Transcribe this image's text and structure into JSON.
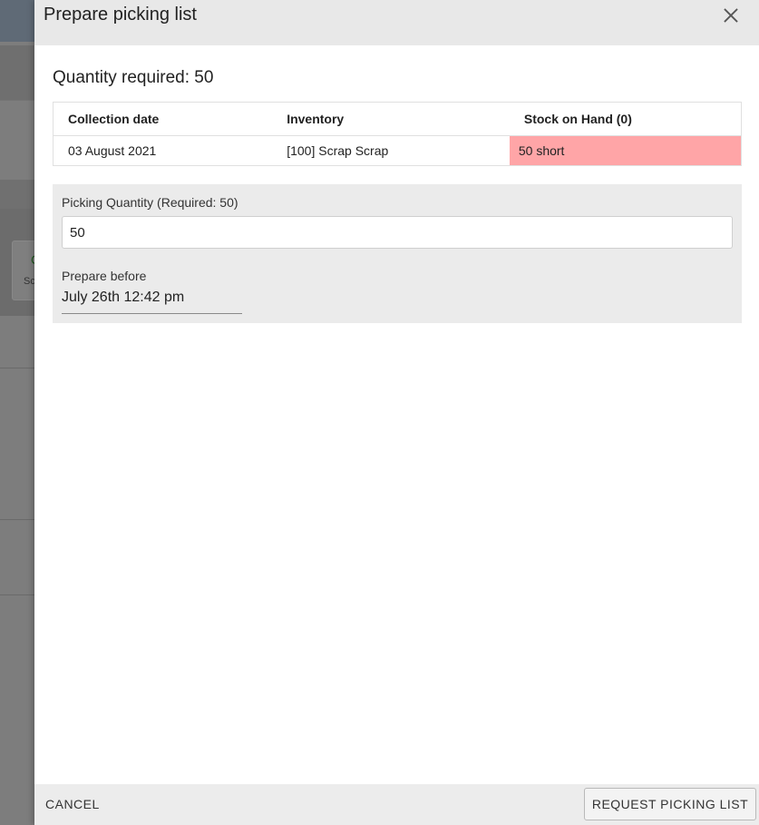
{
  "background": {
    "card_glyph": "C",
    "card_text": "Sc"
  },
  "dialog": {
    "title": "Prepare picking list",
    "close_icon": "close-icon",
    "quantity_required": "Quantity required: 50",
    "table": {
      "headers": [
        "Collection date",
        "Inventory",
        "Stock on Hand (0)"
      ],
      "rows": [
        [
          "03 August 2021",
          "[100] Scrap Scrap",
          "50 short"
        ]
      ],
      "short_color": "#ffa5a7"
    },
    "form": {
      "picking_quantity_label": "Picking Quantity (Required: 50)",
      "picking_quantity_value": "50",
      "prepare_before_label": "Prepare before",
      "prepare_before_value": "July 26th 12:42 pm"
    },
    "footer": {
      "cancel_label": "CANCEL",
      "request_label": "REQUEST PICKING LIST"
    }
  }
}
